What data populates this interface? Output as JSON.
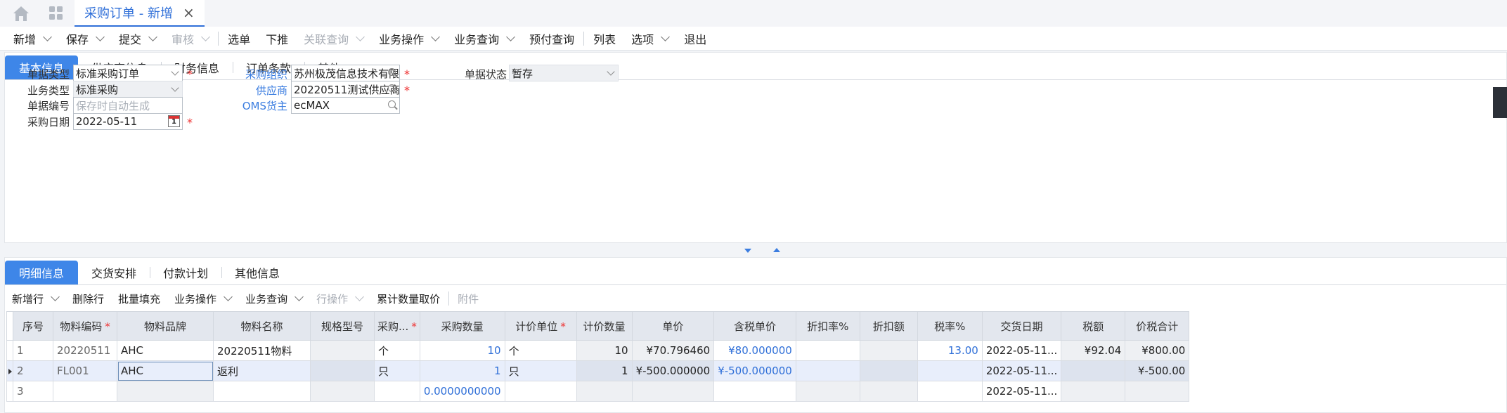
{
  "tab": {
    "title": "采购订单 - 新增"
  },
  "toolbar": [
    {
      "label": "新增",
      "dropdown": true,
      "enabled": true
    },
    {
      "label": "保存",
      "dropdown": true,
      "enabled": true
    },
    {
      "label": "提交",
      "dropdown": true,
      "enabled": true
    },
    {
      "label": "审核",
      "dropdown": true,
      "enabled": false
    },
    {
      "label": "选单",
      "dropdown": false,
      "enabled": true
    },
    {
      "label": "下推",
      "dropdown": false,
      "enabled": true
    },
    {
      "label": "关联查询",
      "dropdown": true,
      "enabled": false
    },
    {
      "label": "业务操作",
      "dropdown": true,
      "enabled": true
    },
    {
      "label": "业务查询",
      "dropdown": true,
      "enabled": true
    },
    {
      "label": "预付查询",
      "dropdown": false,
      "enabled": true
    },
    {
      "label": "列表",
      "dropdown": false,
      "enabled": true
    },
    {
      "label": "选项",
      "dropdown": true,
      "enabled": true
    },
    {
      "label": "退出",
      "dropdown": false,
      "enabled": true
    }
  ],
  "header_tabs": [
    "基本信息",
    "供应商信息",
    "财务信息",
    "订单条款",
    "其他"
  ],
  "form": {
    "bill_type": {
      "label": "单据类型",
      "value": "标准采购订单"
    },
    "biz_type": {
      "label": "业务类型",
      "value": "标准采购"
    },
    "bill_no": {
      "label": "单据编号",
      "placeholder": "保存时自动生成"
    },
    "purchase_date": {
      "label": "采购日期",
      "value": "2022-05-11"
    },
    "purchase_org": {
      "label": "采购组织",
      "value": "苏州极茂信息技术有限公司"
    },
    "supplier": {
      "label": "供应商",
      "value": "20220511测试供应商"
    },
    "oms_owner": {
      "label": "OMS货主",
      "value": "ecMAX"
    },
    "status": {
      "label": "单据状态",
      "value": "暂存"
    },
    "required_mark": "*"
  },
  "detail_tabs": [
    "明细信息",
    "交货安排",
    "付款计划",
    "其他信息"
  ],
  "detail_toolbar": [
    {
      "label": "新增行",
      "dropdown": true,
      "enabled": true
    },
    {
      "label": "删除行",
      "dropdown": false,
      "enabled": true
    },
    {
      "label": "批量填充",
      "dropdown": false,
      "enabled": true
    },
    {
      "label": "业务操作",
      "dropdown": true,
      "enabled": true
    },
    {
      "label": "业务查询",
      "dropdown": true,
      "enabled": true
    },
    {
      "label": "行操作",
      "dropdown": true,
      "enabled": false
    },
    {
      "label": "累计数量取价",
      "dropdown": false,
      "enabled": true
    },
    {
      "label": "附件",
      "dropdown": false,
      "enabled": false
    }
  ],
  "grid": {
    "columns": [
      {
        "label": "序号",
        "required": false
      },
      {
        "label": "物料编码",
        "required": true
      },
      {
        "label": "物料品牌",
        "required": false
      },
      {
        "label": "物料名称",
        "required": false
      },
      {
        "label": "规格型号",
        "required": false
      },
      {
        "label": "采购...",
        "required": true
      },
      {
        "label": "采购数量",
        "required": false
      },
      {
        "label": "计价单位",
        "required": true
      },
      {
        "label": "计价数量",
        "required": false
      },
      {
        "label": "单价",
        "required": false
      },
      {
        "label": "含税单价",
        "required": false
      },
      {
        "label": "折扣率%",
        "required": false
      },
      {
        "label": "折扣额",
        "required": false
      },
      {
        "label": "税率%",
        "required": false
      },
      {
        "label": "交货日期",
        "required": false
      },
      {
        "label": "税额",
        "required": false
      },
      {
        "label": "价税合计",
        "required": false
      }
    ],
    "rows": [
      {
        "seq": "1",
        "code": "20220511",
        "brand": "AHC",
        "name": "20220511物料",
        "spec": "",
        "unit": "个",
        "qty": "10",
        "price_unit": "个",
        "price_qty": "10",
        "price": "¥70.796460",
        "tax_price": "¥80.000000",
        "disc_rate": "",
        "disc_amt": "",
        "tax_rate": "13.00",
        "date": "2022-05-11...",
        "tax": "¥92.04",
        "total": "¥800.00"
      },
      {
        "seq": "2",
        "code": "FL001",
        "brand": "AHC",
        "name": "返利",
        "spec": "",
        "unit": "只",
        "qty": "1",
        "price_unit": "只",
        "price_qty": "1",
        "price": "¥-500.000000",
        "tax_price": "¥-500.000000",
        "disc_rate": "",
        "disc_amt": "",
        "tax_rate": "",
        "date": "2022-05-11...",
        "tax": "",
        "total": "¥-500.00"
      },
      {
        "seq": "3",
        "code": "",
        "brand": "",
        "name": "",
        "spec": "",
        "unit": "",
        "qty": "0.0000000000",
        "price_unit": "",
        "price_qty": "",
        "price": "",
        "tax_price": "",
        "disc_rate": "",
        "disc_amt": "",
        "tax_rate": "",
        "date": "2022-05-11...",
        "tax": "",
        "total": ""
      }
    ]
  }
}
